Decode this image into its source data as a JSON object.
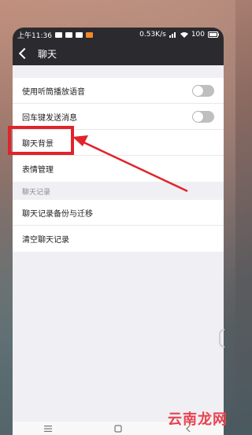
{
  "status_bar": {
    "time": "上午11:36",
    "network_speed": "0.53K/s",
    "battery": "100",
    "icons": [
      "signal-icon",
      "wifi-icon",
      "battery-icon"
    ]
  },
  "header": {
    "back_icon": "chevron-left-icon",
    "title": "聊天"
  },
  "settings": {
    "items": [
      {
        "label": "使用听筒播放语音",
        "control": "toggle-off"
      },
      {
        "label": "回车键发送消息",
        "control": "toggle-off"
      },
      {
        "label": "聊天背景"
      },
      {
        "label": "表情管理"
      }
    ]
  },
  "section": {
    "title": "聊天记录",
    "items": [
      {
        "label": "聊天记录备份与迁移"
      },
      {
        "label": "清空聊天记录"
      }
    ]
  },
  "annotation": {
    "highlight_color": "#e2232a"
  },
  "watermark": {
    "text": "云南龙网"
  },
  "colors": {
    "titlebar_bg": "#2b2b2f",
    "list_bg": "#ffffff",
    "page_bg": "#efeff4",
    "toggle_off": "#bfbfbf"
  }
}
